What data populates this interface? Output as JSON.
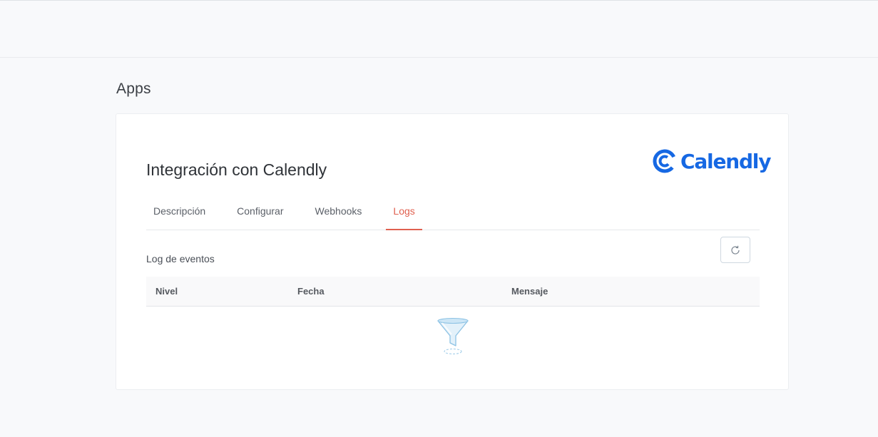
{
  "page": {
    "title": "Apps"
  },
  "card": {
    "title": "Integración con Calendly",
    "logo_text": "Calendly",
    "brand_color": "#1668e3"
  },
  "tabs": [
    {
      "label": "Descripción",
      "active": false
    },
    {
      "label": "Configurar",
      "active": false
    },
    {
      "label": "Webhooks",
      "active": false
    },
    {
      "label": "Logs",
      "active": true
    }
  ],
  "accent_color": "#e0604f",
  "logs": {
    "section_label": "Log de eventos",
    "refresh_icon": "refresh-icon",
    "columns": [
      "Nivel",
      "Fecha",
      "Mensaje"
    ],
    "rows": [],
    "empty_icon": "empty-funnel-icon"
  }
}
